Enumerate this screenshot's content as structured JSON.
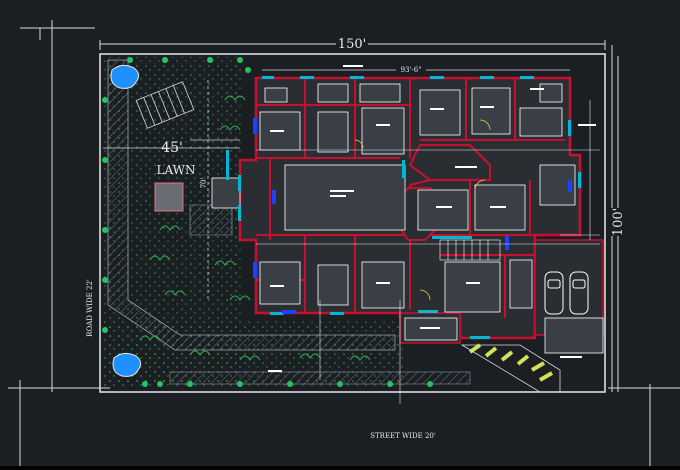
{
  "drawing": {
    "dims": {
      "overall_width": "150'",
      "overall_depth": "100'",
      "house_width": "93'-6\"",
      "lawn_width": "45'",
      "lawn_depth": "70'"
    },
    "labels": {
      "lawn": "LAWN",
      "road_side": "ROAD WIDE 22'",
      "street_front": "STREET WIDE 20'"
    },
    "colors": {
      "background": "#1b1f24",
      "boundary": "#e8e8e8",
      "wall": "#c8102e",
      "room_fill": "#2a2e33",
      "furniture": "#ffffff",
      "window": "#00b8d4",
      "door_blue": "#1e40ff",
      "tree": "#22c55e",
      "hatch": "#7a7f86",
      "pool": "#1e90ff",
      "parking": "#d4e157"
    }
  }
}
